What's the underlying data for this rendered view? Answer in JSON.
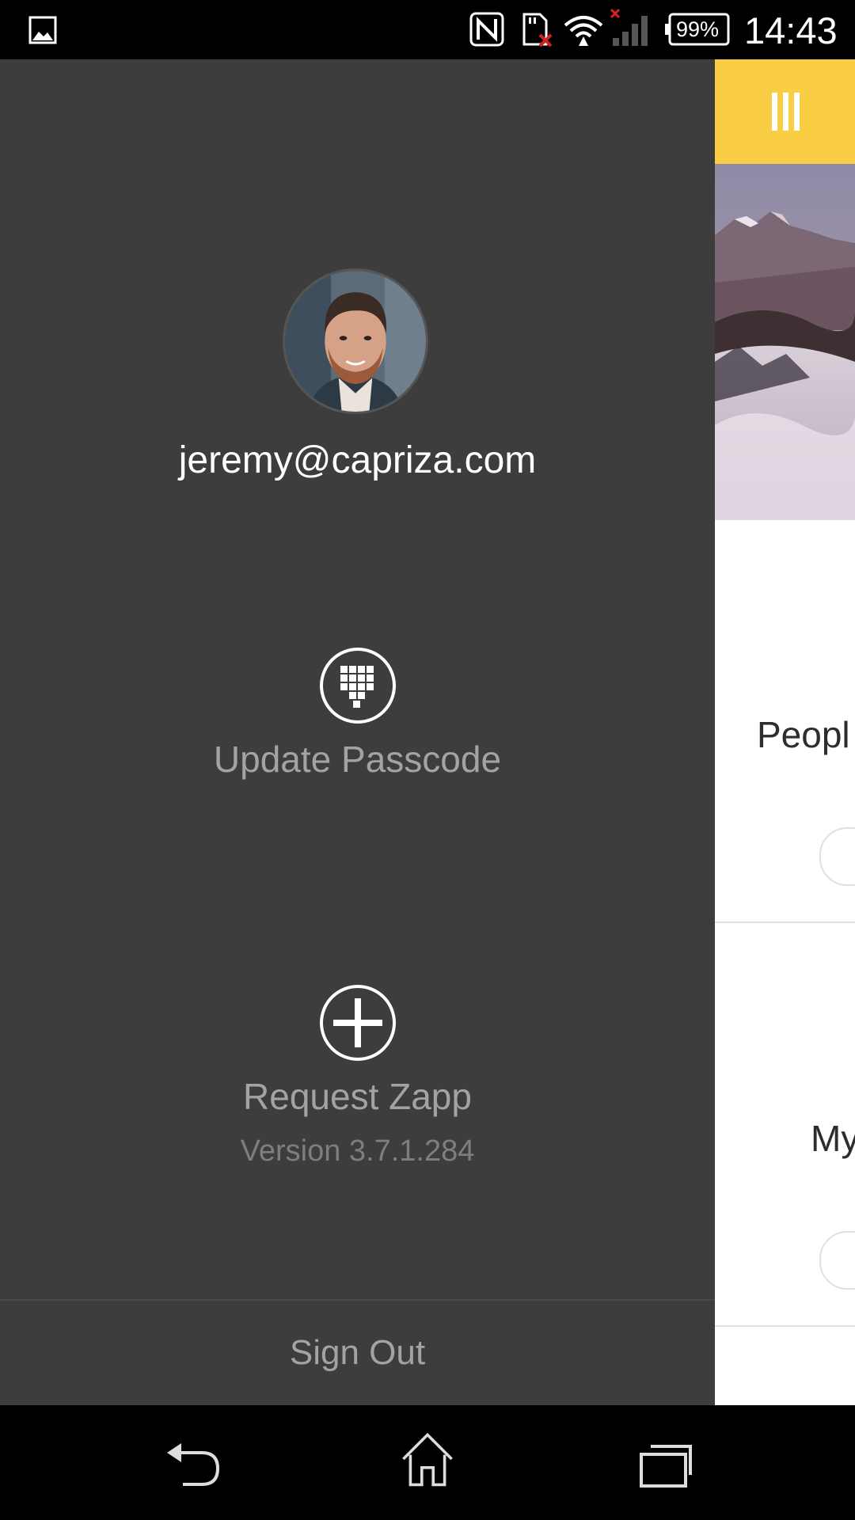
{
  "status_bar": {
    "battery": "99%",
    "time": "14:43",
    "icons": [
      "image-icon",
      "nfc-icon",
      "sd-card-error-icon",
      "wifi-icon",
      "no-signal-icon",
      "battery-icon"
    ]
  },
  "drawer": {
    "user_email": "jeremy@capriza.com",
    "actions": [
      {
        "label": "Update Passcode",
        "icon": "keypad-icon"
      },
      {
        "label": "Request Zapp",
        "icon": "plus-circle-icon"
      }
    ],
    "version": "Version 3.7.1.284",
    "sign_out_label": "Sign Out"
  },
  "app_page": {
    "header_color": "#f9ce45",
    "labels": [
      "Peopl",
      "My"
    ]
  },
  "nav_bar": {
    "buttons": [
      "back-icon",
      "home-icon",
      "recents-icon"
    ]
  }
}
